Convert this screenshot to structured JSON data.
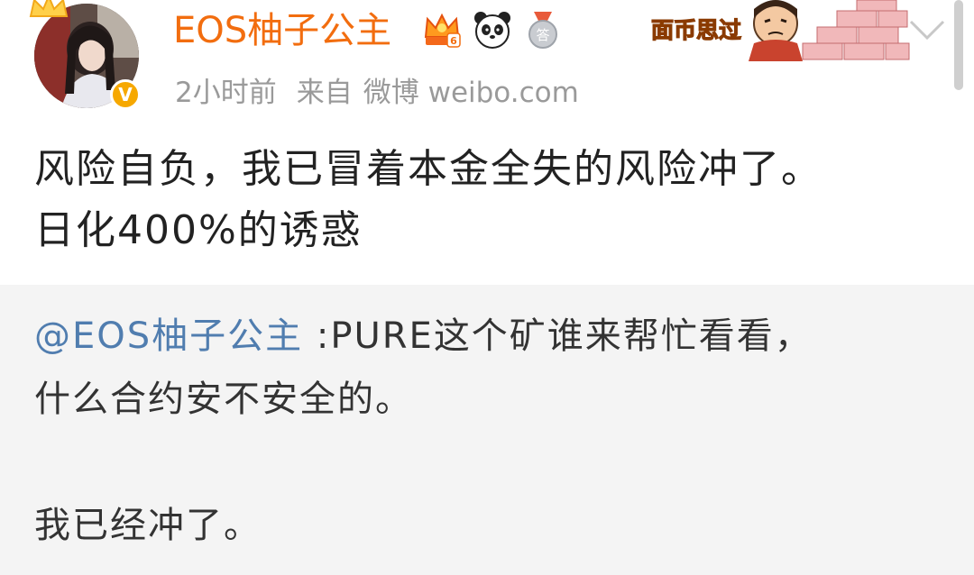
{
  "header": {
    "username": "EOS柚子公主",
    "timestamp": "2小时前",
    "source_label": "来自",
    "source_app": "微博 weibo.com",
    "sticker_text": "面币思过",
    "badges": [
      "vip-crown-badge",
      "panda-badge",
      "answer-medal-badge"
    ],
    "answer_badge_char": "答",
    "vip_level": "6",
    "verified_mark": "V"
  },
  "post": {
    "lines": [
      "风险自负，我已冒着本金全失的风险冲了。",
      "日化400%的诱惑"
    ]
  },
  "repost": {
    "mention": "@EOS柚子公主",
    "line1_rest": " :PURE这个矿谁来帮忙看看，",
    "line2": "什么合约安不安全的。",
    "line4": "我已经冲了。"
  },
  "colors": {
    "username": "#f26d0f",
    "mention": "#507daf",
    "meta": "#9a9a9a",
    "text": "#222222",
    "repost_bg": "#f4f4f4",
    "verified": "#f6a800"
  }
}
